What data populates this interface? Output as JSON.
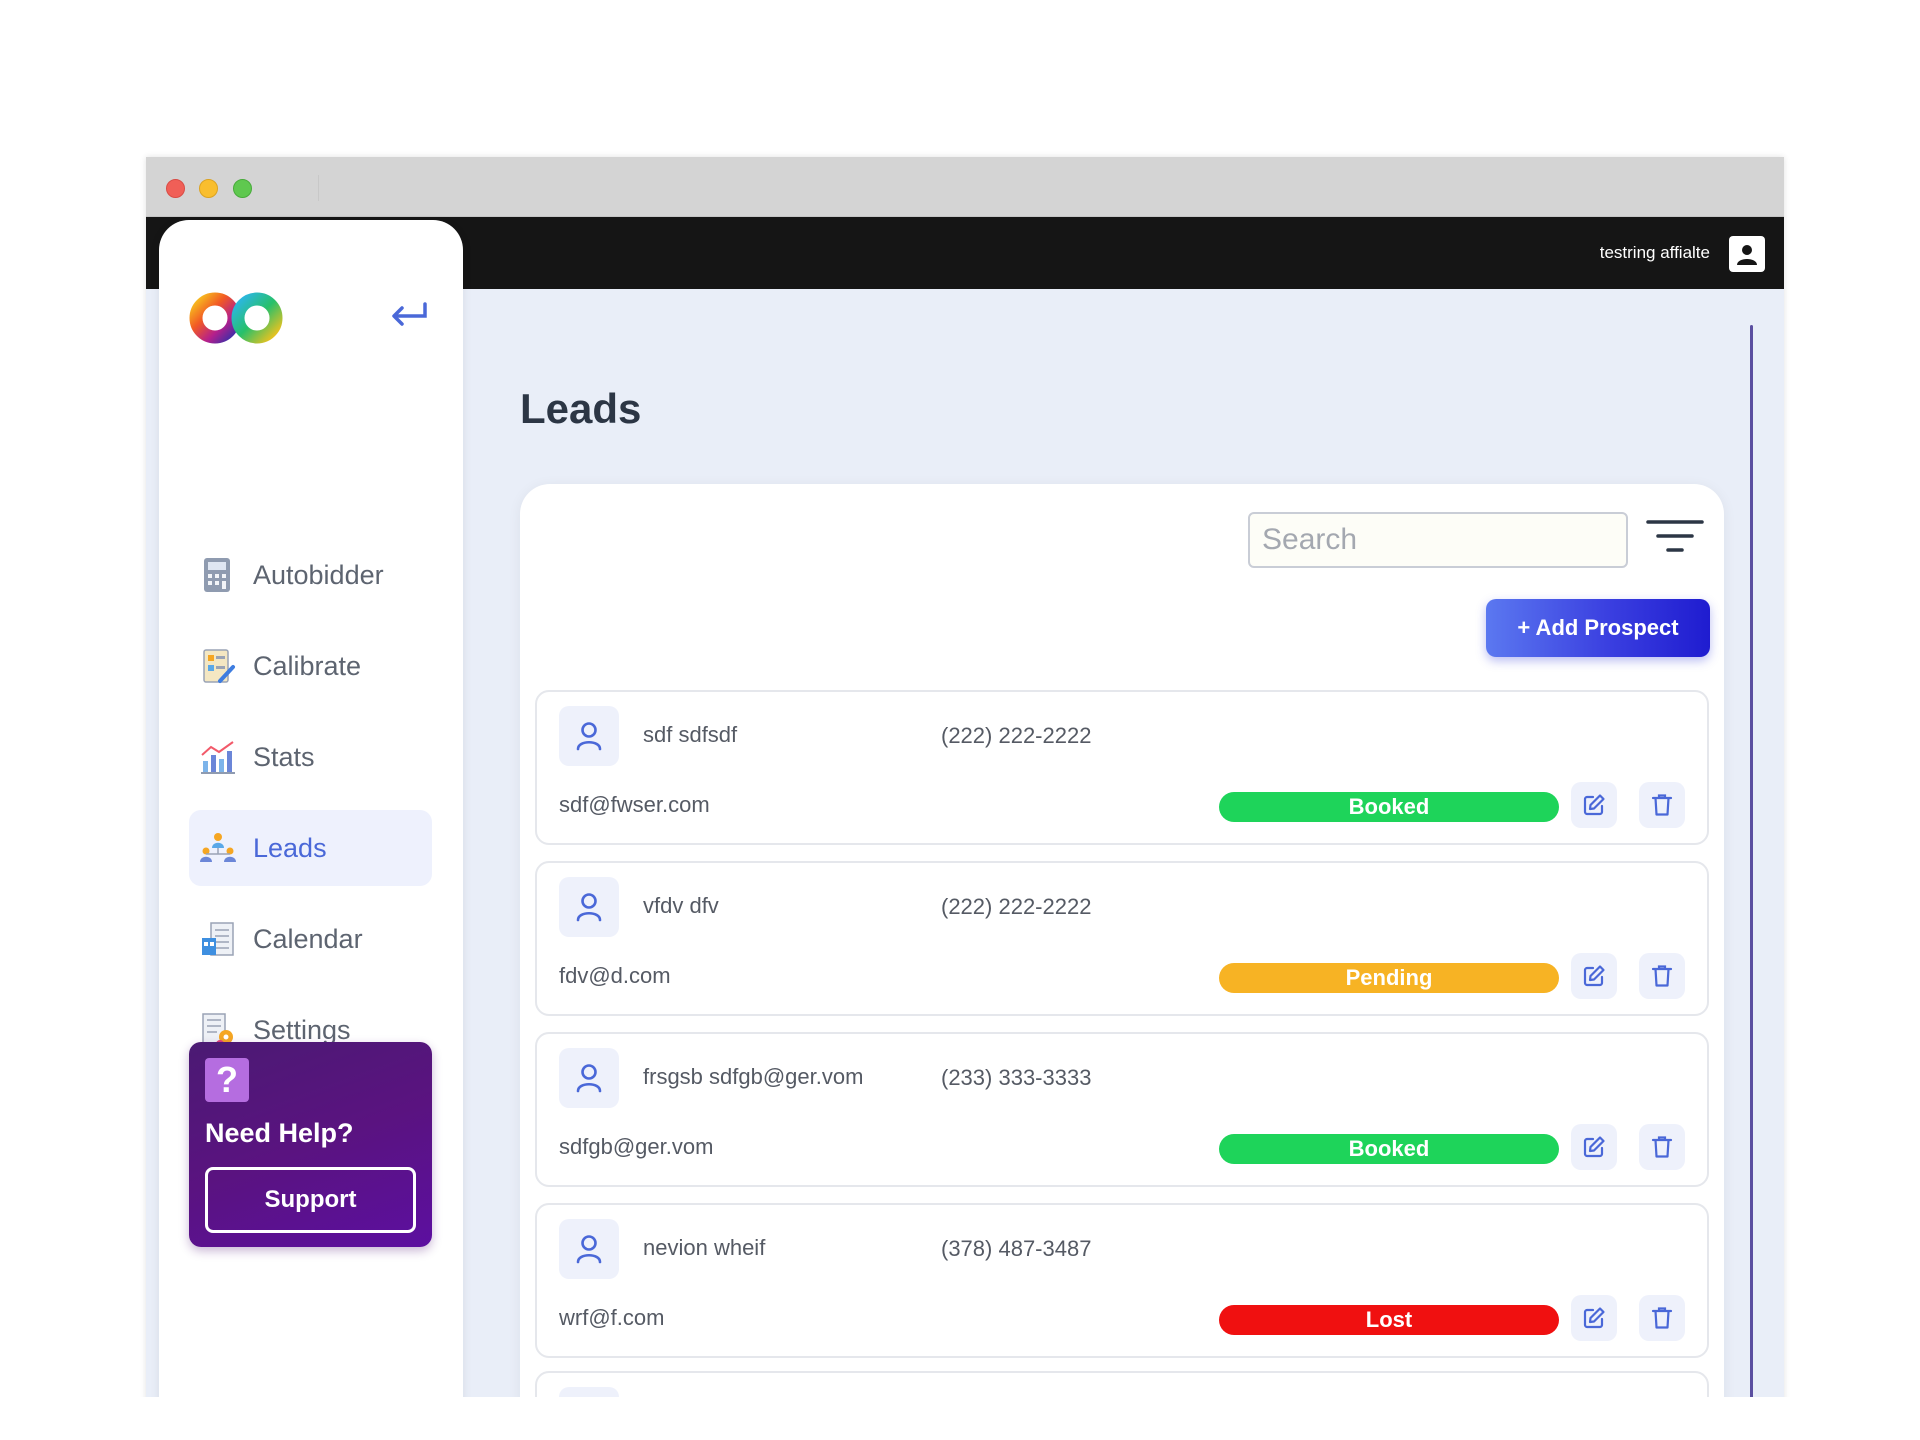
{
  "header": {
    "user_name": "testring affialte"
  },
  "sidebar": {
    "items": [
      {
        "label": "Autobidder",
        "icon": "calculator-icon",
        "active": false
      },
      {
        "label": "Calibrate",
        "icon": "calibrate-icon",
        "active": false
      },
      {
        "label": "Stats",
        "icon": "stats-chart-icon",
        "active": false
      },
      {
        "label": "Leads",
        "icon": "leads-people-icon",
        "active": true
      },
      {
        "label": "Calendar",
        "icon": "calendar-icon",
        "active": false
      },
      {
        "label": "Settings",
        "icon": "settings-gear-icon",
        "active": false
      }
    ],
    "help": {
      "icon": "?",
      "title": "Need Help?",
      "button_label": "Support"
    }
  },
  "main": {
    "title": "Leads",
    "search_placeholder": "Search",
    "add_button_label": "+ Add Prospect",
    "leads": [
      {
        "name": "sdf sdfsdf",
        "phone": "(222) 222-2222",
        "email": "sdf@fwser.com",
        "status": "Booked",
        "status_color": "#1ed45a"
      },
      {
        "name": "vfdv dfv",
        "phone": "(222) 222-2222",
        "email": "fdv@d.com",
        "status": "Pending",
        "status_color": "#f7b324"
      },
      {
        "name": "frsgsb sdfgb@ger.vom",
        "phone": "(233) 333-3333",
        "email": "sdfgb@ger.vom",
        "status": "Booked",
        "status_color": "#1ed45a"
      },
      {
        "name": "nevion wheif",
        "phone": "(378) 487-3487",
        "email": "wrf@f.com",
        "status": "Lost",
        "status_color": "#f01010"
      }
    ]
  },
  "colors": {
    "accent": "#4a68d8",
    "topbar": "#151515",
    "help_bg": "#5a1380"
  }
}
